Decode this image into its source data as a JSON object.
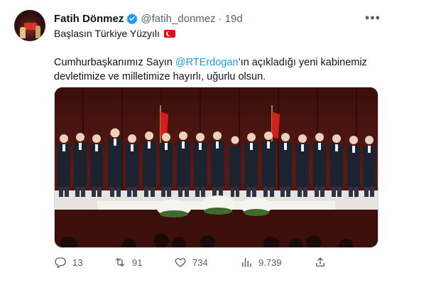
{
  "author": {
    "name": "Fatih Dönmez",
    "handle": "@fatih_donmez",
    "separator": "·",
    "time": "19d",
    "bio": "Başlasın Türkiye Yüzyılı"
  },
  "tweet": {
    "text_before": "Cumhurbaşkanımız Sayın ",
    "mention": "@RTErdogan",
    "text_after": "’ın açıkladığı yeni kabinemiz devletimize ve milletimize hayırlı, uğurlu olsun."
  },
  "stats": {
    "replies": "13",
    "retweets": "91",
    "likes": "734",
    "views": "9.739"
  },
  "colors": {
    "accent": "#1d9bf0",
    "muted": "#536471",
    "flag_red": "#e30a17"
  },
  "icons": [
    "verified-badge-icon",
    "more-icon",
    "turkish-flag-icon",
    "reply-icon",
    "retweet-icon",
    "like-icon",
    "views-icon",
    "share-icon"
  ]
}
